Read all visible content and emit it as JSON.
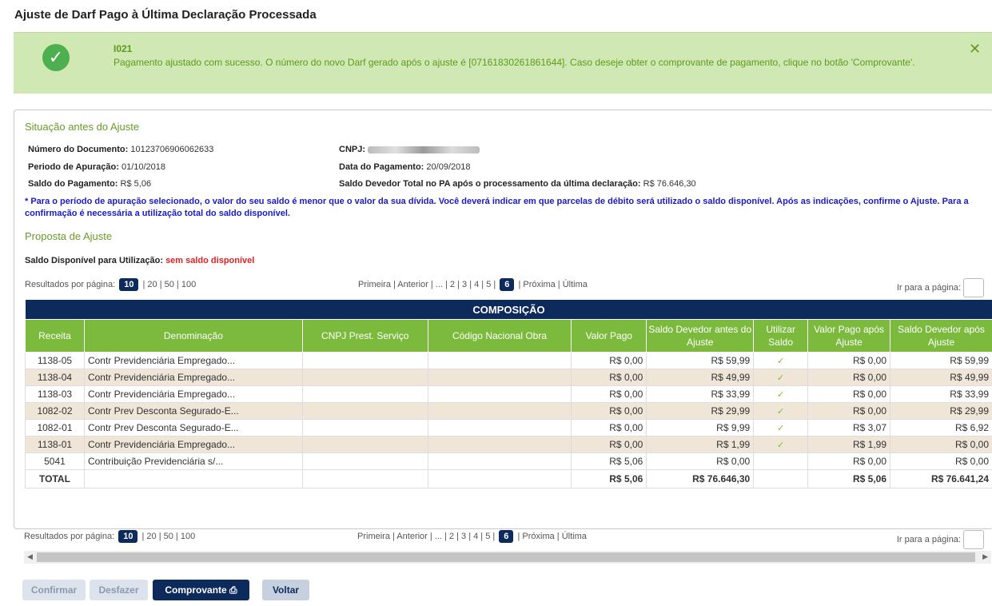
{
  "page_title": "Ajuste de Darf Pago à Última Declaração Processada",
  "alert": {
    "code": "I021",
    "message": "Pagamento ajustado com sucesso. O número do novo Darf gerado após o ajuste é [07161830261861644]. Caso deseje obter o comprovante de pagamento, clique no botão 'Comprovante'.",
    "close_glyph": "✕",
    "check_glyph": "✓"
  },
  "situacao": {
    "title": "Situação antes do Ajuste",
    "numero_label": "Número do Documento:",
    "numero_value": "10123706906062633",
    "cnpj_label": "CNPJ:",
    "periodo_label": "Periodo de Apuração:",
    "periodo_value": "01/10/2018",
    "data_label": "Data do Pagamento:",
    "data_value": "20/09/2018",
    "saldo_label": "Saldo do Pagamento:",
    "saldo_value": "R$ 5,06",
    "devedor_label": "Saldo Devedor Total no PA após o processamento da última declaração:",
    "devedor_value": "R$ 76.646,30",
    "note": "* Para o período de apuração selecionado, o valor do seu saldo é menor que o valor da sua dívida. Você deverá indicar em que parcelas de débito será utilizado o saldo disponível. Após as indicações, confirme o Ajuste. Para a confirmação é necessária a utilização total do saldo disponível."
  },
  "proposta": {
    "title": "Proposta de Ajuste",
    "saldo_label": "Saldo Disponível para Utilização:",
    "saldo_value": "sem saldo disponível"
  },
  "pager": {
    "rpp_label": "Resultados por página:",
    "rpp_selected": "10",
    "rpp_others": "| 20 | 50 | 100",
    "nav_before": "Primeira | Anterior | ... | 2 | 3 | 4 | 5 |",
    "page_selected": "6",
    "nav_after": "| Próxima | Última",
    "goto_label": "Ir para a página:"
  },
  "table": {
    "caption": "COMPOSIÇÃO",
    "headers": [
      "Receita",
      "Denominação",
      "CNPJ Prest. Serviço",
      "Código Nacional Obra",
      "Valor Pago",
      "Saldo Devedor antes do Ajuste",
      "Utilizar Saldo",
      "Valor Pago após Ajuste",
      "Saldo Devedor após Ajuste"
    ],
    "rows": [
      {
        "receita": "1138-05",
        "denom": "Contr Previdenciária Empregado...",
        "cnpj": "",
        "obra": "",
        "valor_pago": "R$ 0,00",
        "saldo_antes": "R$ 59,99",
        "utilizar": "✓",
        "valor_apos": "R$ 0,00",
        "saldo_apos": "R$ 59,99"
      },
      {
        "receita": "1138-04",
        "denom": "Contr Previdenciária Empregado...",
        "cnpj": "",
        "obra": "",
        "valor_pago": "R$ 0,00",
        "saldo_antes": "R$ 49,99",
        "utilizar": "✓",
        "valor_apos": "R$ 0,00",
        "saldo_apos": "R$ 49,99"
      },
      {
        "receita": "1138-03",
        "denom": "Contr Previdenciária Empregado...",
        "cnpj": "",
        "obra": "",
        "valor_pago": "R$ 0,00",
        "saldo_antes": "R$ 33,99",
        "utilizar": "✓",
        "valor_apos": "R$ 0,00",
        "saldo_apos": "R$ 33,99"
      },
      {
        "receita": "1082-02",
        "denom": "Contr Prev Desconta Segurado-E...",
        "cnpj": "",
        "obra": "",
        "valor_pago": "R$ 0,00",
        "saldo_antes": "R$ 29,99",
        "utilizar": "✓",
        "valor_apos": "R$ 0,00",
        "saldo_apos": "R$ 29,99"
      },
      {
        "receita": "1082-01",
        "denom": "Contr Prev Desconta Segurado-E...",
        "cnpj": "",
        "obra": "",
        "valor_pago": "R$ 0,00",
        "saldo_antes": "R$ 9,99",
        "utilizar": "✓",
        "valor_apos": "R$ 3,07",
        "saldo_apos": "R$ 6,92"
      },
      {
        "receita": "1138-01",
        "denom": "Contr Previdenciária Empregado...",
        "cnpj": "",
        "obra": "",
        "valor_pago": "R$ 0,00",
        "saldo_antes": "R$ 1,99",
        "utilizar": "✓",
        "valor_apos": "R$ 1,99",
        "saldo_apos": "R$ 0,00"
      },
      {
        "receita": "5041",
        "denom": "Contribuição Previdenciária s/...",
        "cnpj": "",
        "obra": "",
        "valor_pago": "R$ 5,06",
        "saldo_antes": "R$ 0,00",
        "utilizar": "",
        "valor_apos": "R$ 0,00",
        "saldo_apos": "R$ 0,00"
      }
    ],
    "total": {
      "label": "TOTAL",
      "valor_pago": "R$ 5,06",
      "saldo_antes": "R$ 76.646,30",
      "valor_apos": "R$ 5,06",
      "saldo_apos": "R$ 76.641,24"
    }
  },
  "buttons": {
    "confirmar": "Confirmar",
    "desfazer": "Desfazer",
    "comprovante": "Comprovante",
    "voltar": "Voltar"
  },
  "colors": {
    "green": "#7cba3d",
    "navy": "#0d2a5c",
    "alert_bg": "#cfe8b4",
    "row_alt": "#efe6d8"
  }
}
